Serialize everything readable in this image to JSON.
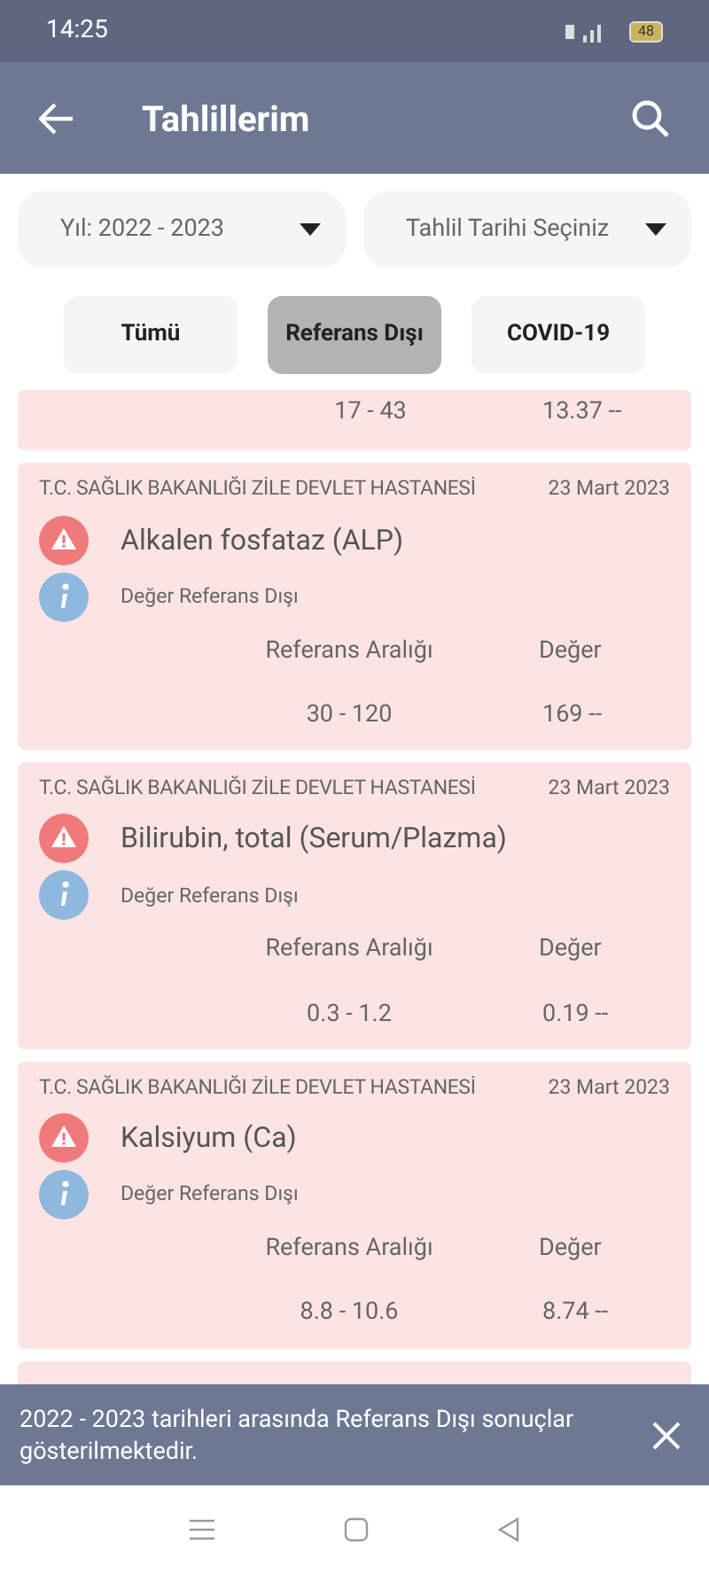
{
  "status_bar": {
    "time": "14:25",
    "battery": "48"
  },
  "header": {
    "title": "Tahlillerim"
  },
  "filters": [
    {
      "label": "Yıl: 2022 - 2023"
    },
    {
      "label": "Tahlil Tarihi Seçiniz"
    }
  ],
  "tabs": [
    {
      "label": "Tümü",
      "selected": false
    },
    {
      "label": "Referans Dışı",
      "selected": true
    },
    {
      "label": "COVID-19",
      "selected": false
    }
  ],
  "partial_result": {
    "range": "17 - 43",
    "value": "13.37 --"
  },
  "results": [
    {
      "hospital": "T.C. SAĞLIK BAKANLIĞI ZİLE DEVLET HASTANESİ",
      "date": "23 Mart 2023",
      "name": "Alkalen fosfataz (ALP)",
      "status": "Değer Referans Dışı",
      "range_label": "Referans Aralığı",
      "value_label": "Değer",
      "range": "30 - 120",
      "value": "169 --"
    },
    {
      "hospital": "T.C. SAĞLIK BAKANLIĞI ZİLE DEVLET HASTANESİ",
      "date": "23 Mart 2023",
      "name": "Bilirubin, total (Serum/Plazma)",
      "status": "Değer Referans Dışı",
      "range_label": "Referans Aralığı",
      "value_label": "Değer",
      "range": "0.3 - 1.2",
      "value": "0.19 --"
    },
    {
      "hospital": "T.C. SAĞLIK BAKANLIĞI ZİLE DEVLET HASTANESİ",
      "date": "23 Mart 2023",
      "name": "Kalsiyum (Ca)",
      "status": "Değer Referans Dışı",
      "range_label": "Referans Aralığı",
      "value_label": "Değer",
      "range": "8.8 - 10.6",
      "value": "8.74 --"
    }
  ],
  "snackbar": {
    "message": "2022 - 2023 tarihleri arasında Referans Dışı sonuçlar gösterilmektedir."
  }
}
